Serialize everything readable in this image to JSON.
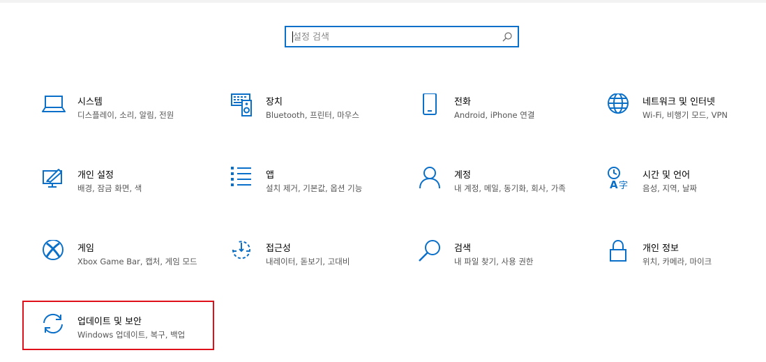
{
  "search": {
    "placeholder": "설정 검색",
    "value": ""
  },
  "tiles": [
    {
      "title": "시스템",
      "desc": "디스플레이, 소리, 알림, 전원",
      "icon": "laptop-icon"
    },
    {
      "title": "장치",
      "desc": "Bluetooth, 프린터, 마우스",
      "icon": "devices-icon"
    },
    {
      "title": "전화",
      "desc": "Android, iPhone 연결",
      "icon": "phone-icon"
    },
    {
      "title": "네트워크 및 인터넷",
      "desc": "Wi-Fi, 비행기 모드, VPN",
      "icon": "globe-icon"
    },
    {
      "title": "개인 설정",
      "desc": "배경, 잠금 화면, 색",
      "icon": "personalization-icon"
    },
    {
      "title": "앱",
      "desc": "설치 제거, 기본값, 옵션 기능",
      "icon": "apps-list-icon"
    },
    {
      "title": "계정",
      "desc": "내 계정, 메일, 동기화, 회사, 가족",
      "icon": "account-icon"
    },
    {
      "title": "시간 및 언어",
      "desc": "음성, 지역, 날짜",
      "icon": "time-language-icon"
    },
    {
      "title": "게임",
      "desc": "Xbox Game Bar, 캡처, 게임 모드",
      "icon": "xbox-icon"
    },
    {
      "title": "접근성",
      "desc": "내레이터, 돋보기, 고대비",
      "icon": "ease-of-access-icon"
    },
    {
      "title": "검색",
      "desc": "내 파일 찾기, 사용 권한",
      "icon": "search-icon"
    },
    {
      "title": "개인 정보",
      "desc": "위치, 카메라, 마이크",
      "icon": "lock-icon"
    },
    {
      "title": "업데이트 및 보안",
      "desc": "Windows 업데이트, 복구, 백업",
      "icon": "update-sync-icon"
    }
  ],
  "colors": {
    "accent": "#0a6fc8",
    "highlight": "#e0101a"
  }
}
